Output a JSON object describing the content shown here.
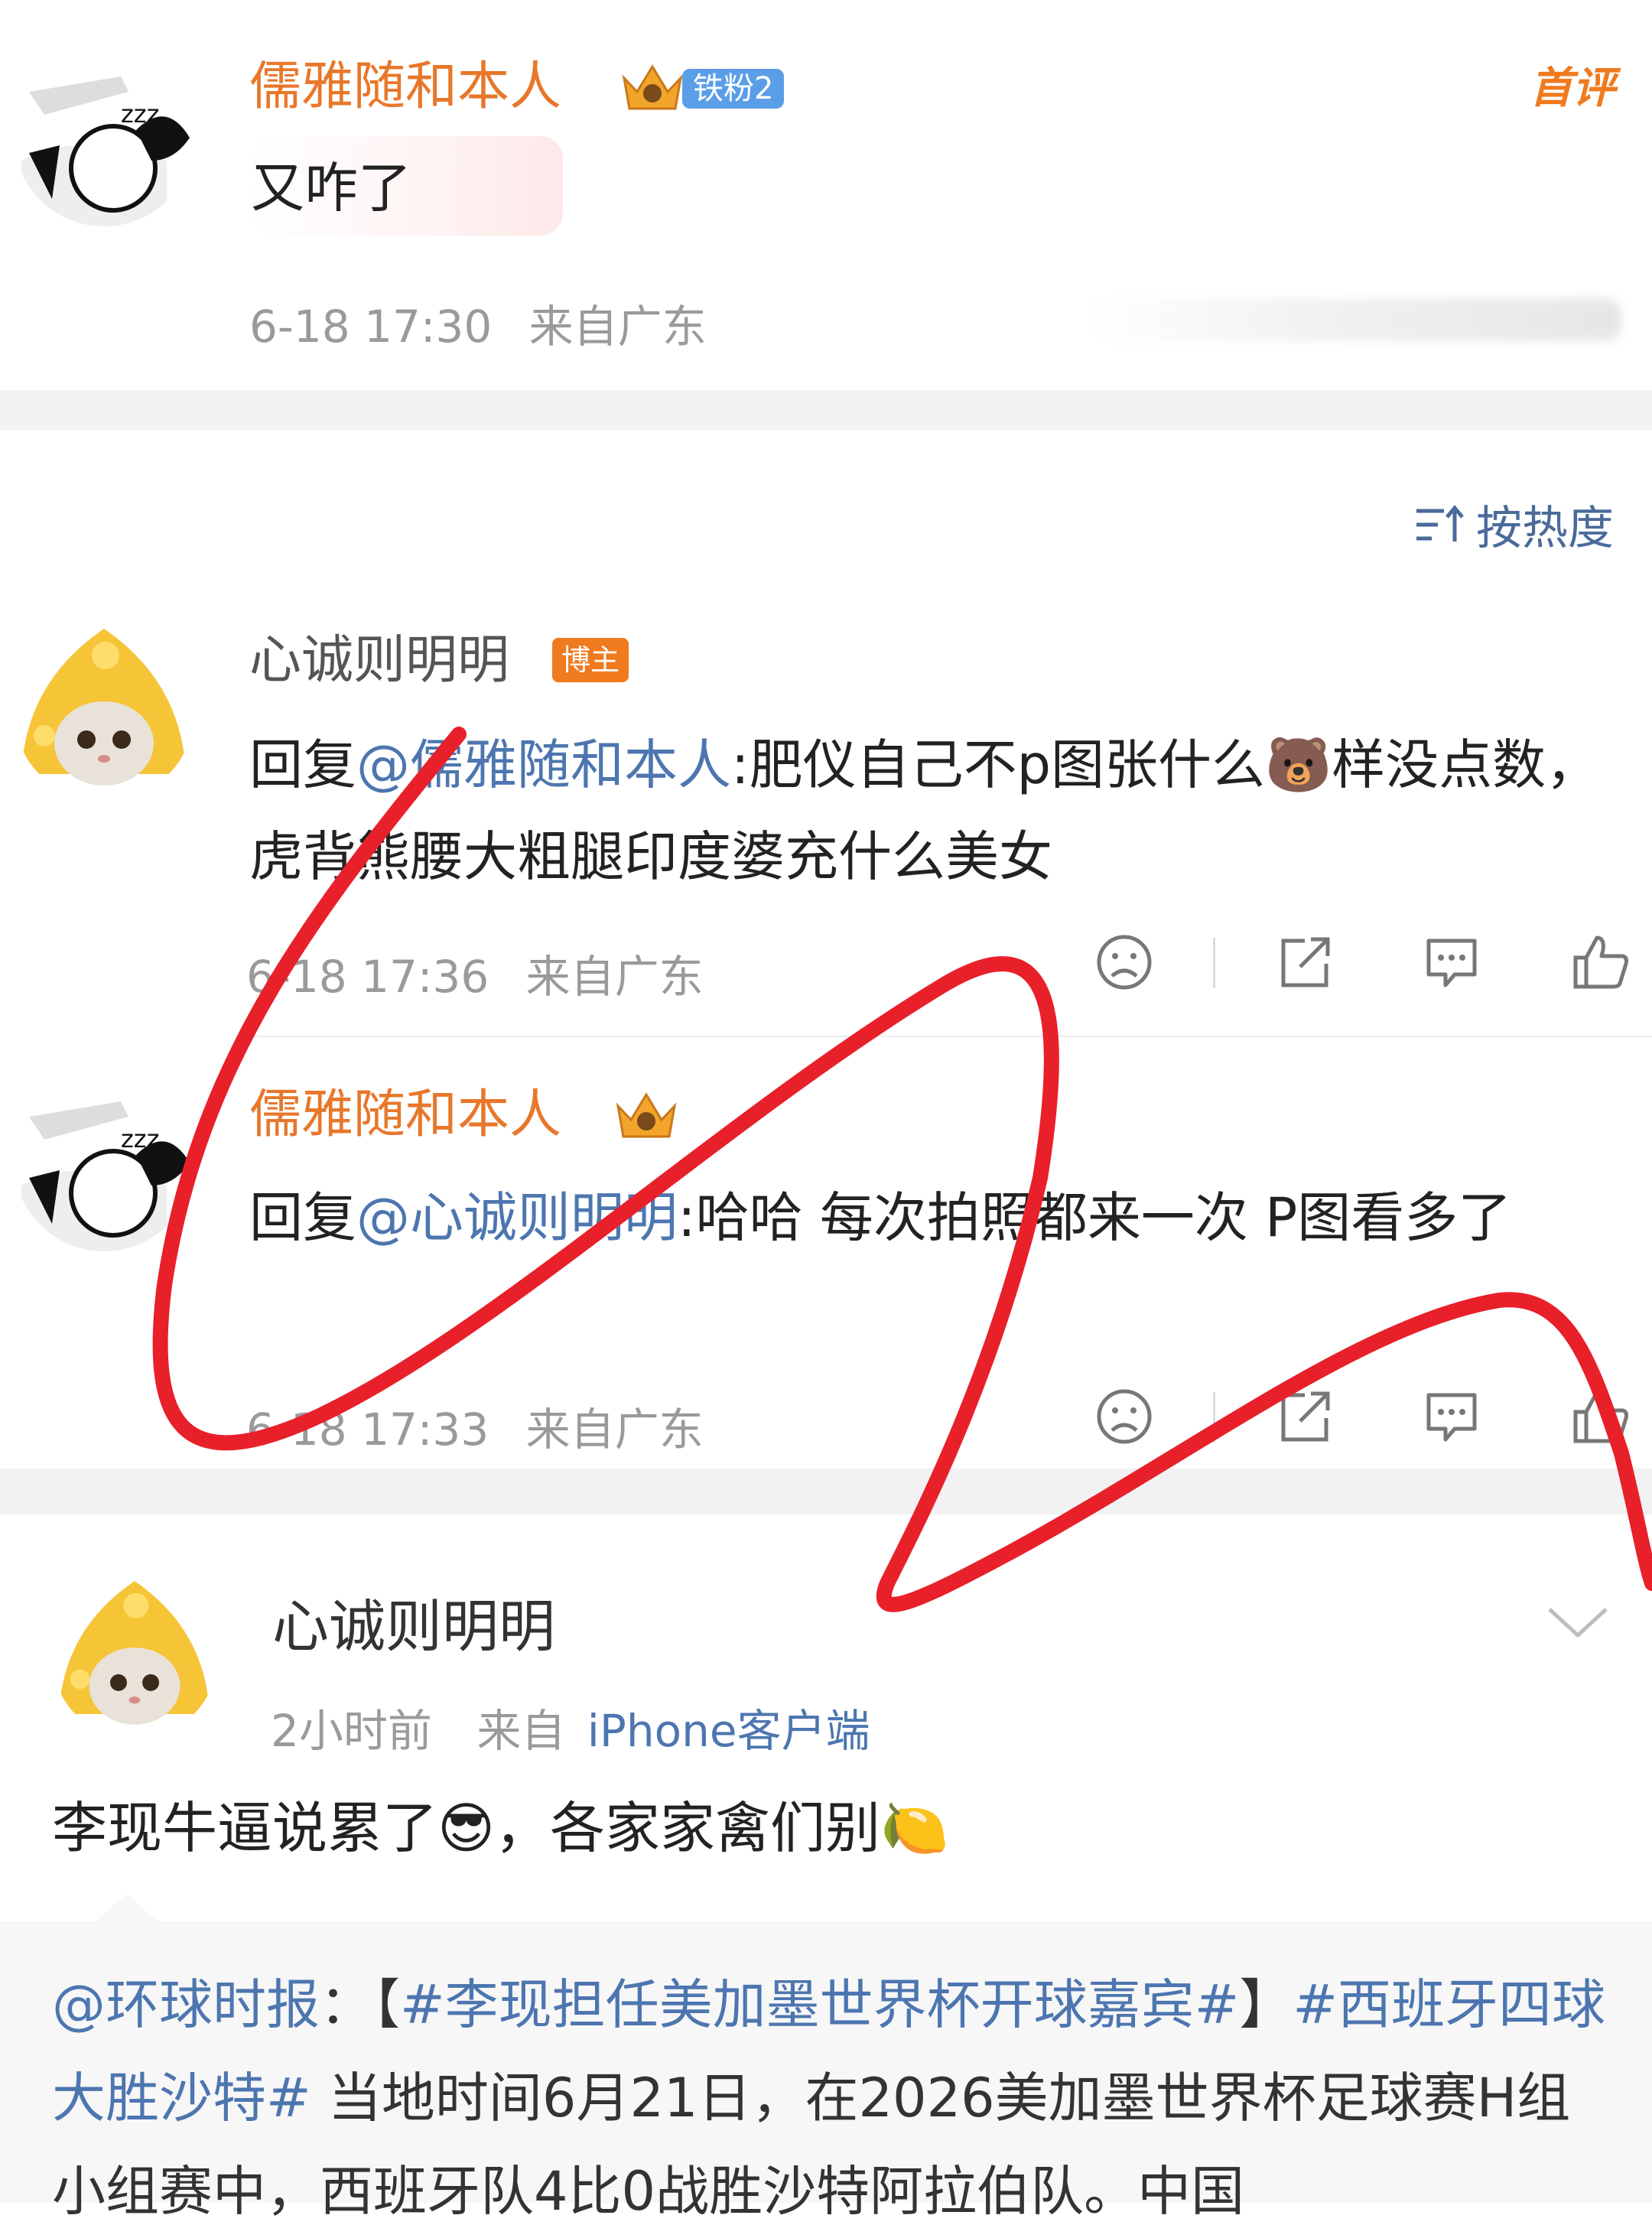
{
  "first_comment": {
    "username": "儒雅随和本人",
    "fan_badge": "铁粉2",
    "top_badge": "首评",
    "text": "又咋了",
    "time": "6-18 17:30",
    "source": "来自广东"
  },
  "sort": {
    "label": "按热度"
  },
  "replies": [
    {
      "username": "心诚则明明",
      "badge": "博主",
      "reply_prefix": "回复",
      "mention": "@儒雅随和本人",
      "text": ":肥仪自己不p图张什么🐻样没点数，虎背熊腰大粗腿印度婆充什么美女",
      "time": "6-18 17:36",
      "source": "来自广东"
    },
    {
      "username": "儒雅随和本人",
      "reply_prefix": "回复",
      "mention": "@心诚则明明",
      "text": ":哈哈 每次拍照都来一次 P图看多了",
      "time": "6-18 17:33",
      "source": "来自广东"
    }
  ],
  "post": {
    "username": "心诚则明明",
    "time": "2小时前",
    "source_prefix": "来自",
    "source_client": "iPhone客户端",
    "text": "李现牛逼说累了😎，各家家禽们别🍋",
    "quote": {
      "author": "@环球时报",
      "colon": "：",
      "bracket_open": "【",
      "topic1": "#李现担任美加墨世界杯开球嘉宾#",
      "bracket_close": "】",
      "topic2": "#西班牙四球大胜沙特#",
      "body": " 当地时间6月21日，在2026美加墨世界杯足球赛H组小组赛中，西班牙队4比0战胜沙特阿拉伯队。中国"
    }
  },
  "colors": {
    "username_orange": "#e8772a",
    "link_blue": "#4d76b0",
    "annotation_red": "#e8202a"
  }
}
